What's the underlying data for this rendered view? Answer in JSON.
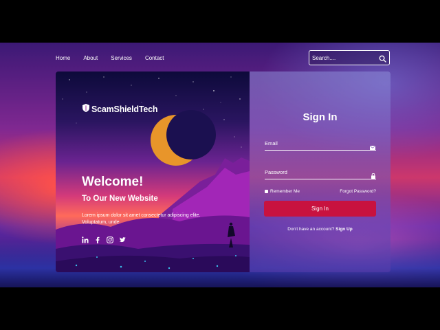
{
  "nav": {
    "items": [
      "Home",
      "About",
      "Services",
      "Contact"
    ]
  },
  "search": {
    "placeholder": "Search...."
  },
  "brand": {
    "name": "ScamShieldTech"
  },
  "hero": {
    "welcome": "Welcome!",
    "subtitle": "To Our New Website",
    "description": "Lorem ipsum dolor sit amet consectetur adipiscing elite. Voluptatum, unde."
  },
  "social": [
    "linkedin-icon",
    "facebook-icon",
    "instagram-icon",
    "twitter-icon"
  ],
  "signin": {
    "title": "Sign In",
    "email_label": "Email",
    "password_label": "Password",
    "remember_label": "Remember Me",
    "forgot_label": "Forgot Password?",
    "button_label": "Sign In",
    "signup_prompt": "Don't have an account?",
    "signup_link": "Sign Up"
  },
  "colors": {
    "accent": "#c8123f"
  }
}
